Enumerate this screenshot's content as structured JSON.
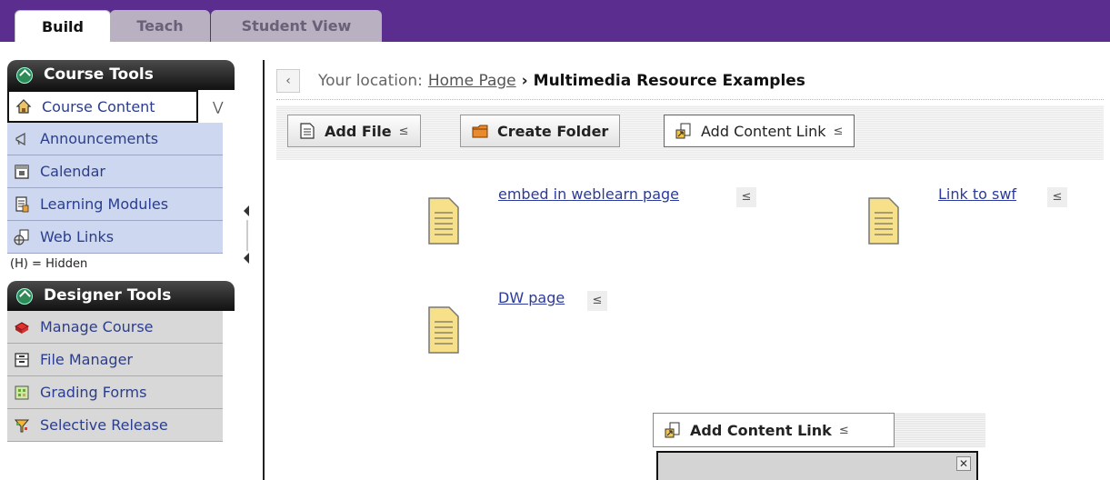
{
  "tabs": [
    {
      "label": "Build",
      "active": true
    },
    {
      "label": "Teach",
      "active": false
    },
    {
      "label": "Student View",
      "active": false
    }
  ],
  "course_tools": {
    "title": "Course Tools",
    "items": [
      {
        "label": "Course Content",
        "icon": "house-icon"
      },
      {
        "label": "Announcements",
        "icon": "megaphone-icon"
      },
      {
        "label": "Calendar",
        "icon": "calendar-icon"
      },
      {
        "label": "Learning Modules",
        "icon": "module-icon"
      },
      {
        "label": "Web Links",
        "icon": "globe-link-icon"
      }
    ],
    "hidden_note": "(H) = Hidden"
  },
  "designer_tools": {
    "title": "Designer Tools",
    "items": [
      {
        "label": "Manage Course",
        "icon": "toolbox-icon"
      },
      {
        "label": "File Manager",
        "icon": "file-manager-icon"
      },
      {
        "label": "Grading Forms",
        "icon": "grading-icon"
      },
      {
        "label": "Selective Release",
        "icon": "release-icon"
      }
    ]
  },
  "breadcrumb": {
    "label": "Your location:",
    "home": "Home Page",
    "separator": "›",
    "current": "Multimedia Resource Examples"
  },
  "toolbar": {
    "add_file": "Add File",
    "create_folder": "Create Folder",
    "add_content_link": "Add Content Link"
  },
  "items": [
    {
      "label": "embed in weblearn page"
    },
    {
      "label": "Link to swf"
    },
    {
      "label": "DW page"
    }
  ],
  "floating_menu": {
    "button_label": "Add Content Link"
  },
  "colors": {
    "brand_purple": "#5b2d8e",
    "course_tool_bg": "#cdd7ef",
    "designer_tool_bg": "#d8d8d8",
    "link": "#2b3a9b"
  }
}
